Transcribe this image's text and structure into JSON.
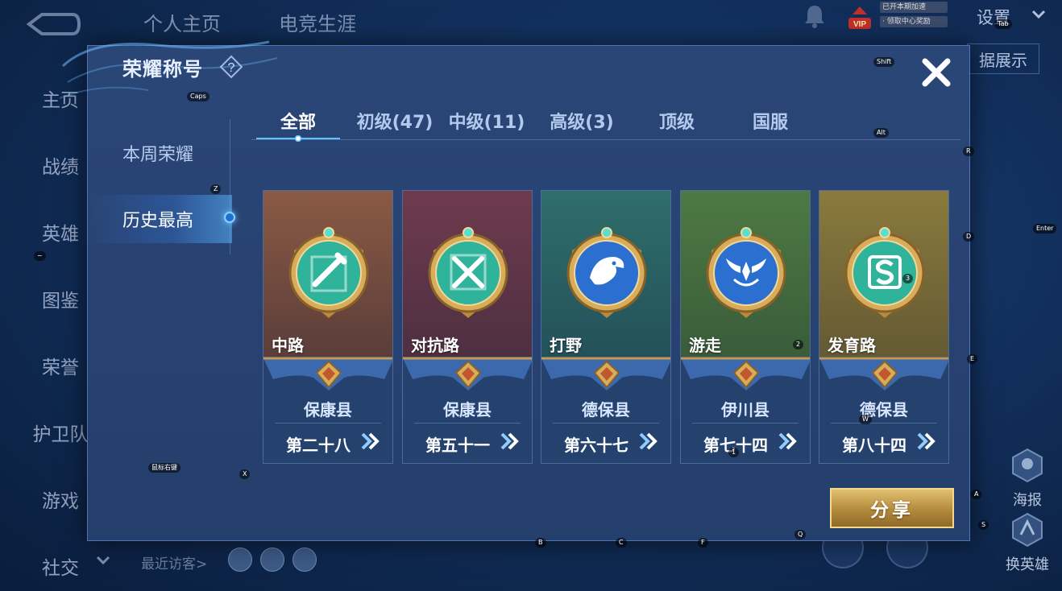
{
  "background": {
    "top_tabs": [
      "个人主页",
      "电竞生涯"
    ],
    "left_nav": [
      "主页",
      "战绩",
      "英雄",
      "图鉴",
      "荣誉",
      "护卫队",
      "游戏",
      "社交"
    ],
    "settings_label": "设置",
    "data_display_label": "据展示",
    "recent_visitors_label": "最近访客>",
    "side_buttons": [
      "海报",
      "换英雄"
    ]
  },
  "modal": {
    "title": "荣耀称号",
    "side_tabs": [
      "本周荣耀",
      "历史最高"
    ],
    "active_side_tab": "历史最高",
    "tabs": [
      "全部",
      "初级(47)",
      "中级(11)",
      "高级(3)",
      "顶级",
      "国服"
    ],
    "active_tab": "全部",
    "cards": [
      {
        "role": "中路",
        "region": "保康县",
        "rank": "第二十八",
        "bg_top": "#8a5a44",
        "bg_bottom": "#5b3d3a",
        "badge_color": "#2fb39a",
        "badge_icon": "sword-icon"
      },
      {
        "role": "对抗路",
        "region": "保康县",
        "rank": "第五十一",
        "bg_top": "#6e3b4d",
        "bg_bottom": "#4e2f42",
        "badge_color": "#2fb39a",
        "badge_icon": "crossed-swords-icon"
      },
      {
        "role": "打野",
        "region": "德保县",
        "rank": "第六十七",
        "bg_top": "#2f6e6a",
        "bg_bottom": "#23515a",
        "badge_color": "#2b6fd1",
        "badge_icon": "dragon-icon"
      },
      {
        "role": "游走",
        "region": "伊川县",
        "rank": "第七十四",
        "bg_top": "#4d7a43",
        "bg_bottom": "#3a5c3a",
        "badge_color": "#2b6fd1",
        "badge_icon": "wings-icon"
      },
      {
        "role": "发育路",
        "region": "德保县",
        "rank": "第八十四",
        "bg_top": "#8a7a3c",
        "bg_bottom": "#645a34",
        "badge_color": "#2fb39a",
        "badge_icon": "shield-s-icon"
      }
    ],
    "share_label": "分享"
  },
  "key_hints": [
    "Tab",
    "Shift",
    "Caps",
    "Alt",
    "R",
    "Z",
    "D",
    "Enter",
    "3",
    "2",
    "E",
    "W",
    "1",
    "A",
    "X",
    "S",
    "B",
    "C",
    "F",
    "Q",
    "~",
    "鼠标右键"
  ],
  "vip_lines": [
    "已开本期加速",
    "· 领取中心奖励"
  ],
  "vip_label": "VIP"
}
